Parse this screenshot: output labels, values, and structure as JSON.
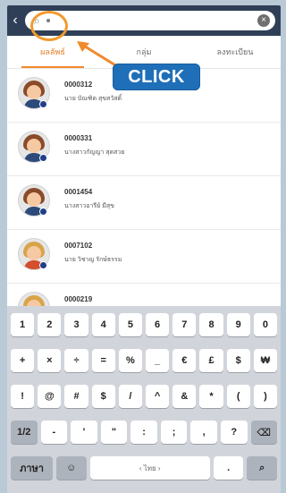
{
  "topbar": {
    "back_icon": "chevron-left-icon",
    "search": {
      "value": "",
      "search_icon": "search-icon",
      "clear_icon": "clear-icon"
    }
  },
  "tabs": [
    {
      "label": "ผลลัพธ์",
      "active": true
    },
    {
      "label": "กลุ่ม",
      "active": false
    },
    {
      "label": "ลงทะเบียน",
      "active": false
    }
  ],
  "callout": {
    "label": "CLICK",
    "color": "#1f6fb8"
  },
  "highlight_color": "#f29a2e",
  "contacts": [
    {
      "code": "0000312",
      "name": "นาย บัณฑิต สุขสวัสดิ์",
      "avatar": "female"
    },
    {
      "code": "0000331",
      "name": "นางสาวกัญญา สุดสวย",
      "avatar": "female"
    },
    {
      "code": "0001454",
      "name": "นางสาวอารีย์ มีสุข",
      "avatar": "female"
    },
    {
      "code": "0007102",
      "name": "นาย วิชาญ รักษ์ธรรม",
      "avatar": "male"
    },
    {
      "code": "0000219",
      "name": "",
      "avatar": "male"
    }
  ],
  "keyboard": {
    "row1": [
      "1",
      "2",
      "3",
      "4",
      "5",
      "6",
      "7",
      "8",
      "9",
      "0"
    ],
    "row2": [
      "+",
      "×",
      "÷",
      "=",
      "%",
      "_",
      "€",
      "£",
      "$",
      "₩"
    ],
    "row3": [
      "!",
      "@",
      "#",
      "$",
      "/",
      "^",
      "&",
      "*",
      "(",
      ")"
    ],
    "row4": [
      "1/2",
      "-",
      "'",
      "\"",
      ":",
      ";",
      ",",
      "?",
      "⌫"
    ],
    "row5": {
      "lang": "ภาษา",
      "emoji": "☺",
      "space": "‹ ไทย ›",
      "dot": ".",
      "search": "⌕"
    }
  }
}
